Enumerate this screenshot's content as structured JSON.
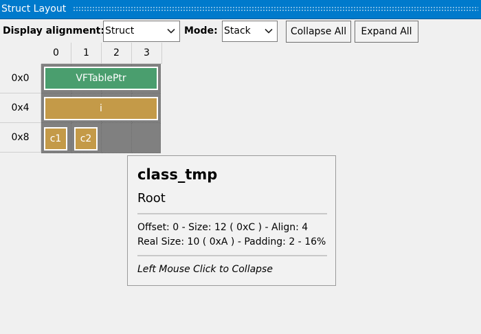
{
  "window": {
    "title": "Struct Layout"
  },
  "toolbar": {
    "alignment_label": "Display alignment:",
    "alignment_value": "Struct",
    "mode_label": "Mode:",
    "mode_value": "Stack",
    "collapse_all": "Collapse All",
    "expand_all": "Expand All"
  },
  "grid": {
    "columns": [
      "0",
      "1",
      "2",
      "3"
    ],
    "rows": [
      "0x0",
      "0x4",
      "0x8"
    ],
    "fields": [
      {
        "name": "VFTablePtr",
        "color": "#4a9e6e"
      },
      {
        "name": "i",
        "color": "#c49a48"
      },
      {
        "name": "c1",
        "color": "#c49a48"
      },
      {
        "name": "c2",
        "color": "#c49a48"
      }
    ],
    "unused_color": "#808080"
  },
  "tooltip": {
    "name": "class_tmp",
    "kind": "Root",
    "line1": "Offset: 0 - Size: 12 ( 0xC ) - Align: 4",
    "line2": "Real Size: 10 ( 0xA ) - Padding: 2 - 16%",
    "hint": "Left Mouse Click to Collapse"
  },
  "colors": {
    "titlebar": "#007acc"
  }
}
